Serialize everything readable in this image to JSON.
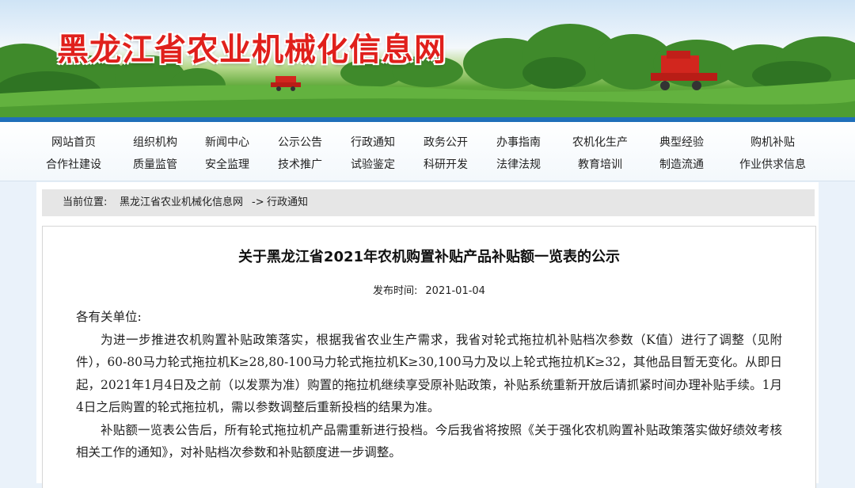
{
  "site": {
    "title": "黑龙江省农业机械化信息网"
  },
  "nav": {
    "row1": [
      "网站首页",
      "组织机构",
      "新闻中心",
      "公示公告",
      "行政通知",
      "政务公开",
      "办事指南",
      "农机化生产",
      "典型经验",
      "购机补贴"
    ],
    "row2": [
      "合作社建设",
      "质量监管",
      "安全监理",
      "技术推广",
      "试验鉴定",
      "科研开发",
      "法律法规",
      "教育培训",
      "制造流通",
      "作业供求信息"
    ]
  },
  "breadcrumb": {
    "label": "当前位置:",
    "home": "黑龙江省农业机械化信息网",
    "separator": "->",
    "current": "行政通知"
  },
  "article": {
    "title": "关于黑龙江省2021年农机购置补贴产品补贴额一览表的公示",
    "date_label": "发布时间:",
    "date": "2021-01-04",
    "salutation": "各有关单位:",
    "paragraphs": [
      "为进一步推进农机购置补贴政策落实，根据我省农业生产需求，我省对轮式拖拉机补贴档次参数（K值）进行了调整（见附件），60-80马力轮式拖拉机K≥28,80-100马力轮式拖拉机K≥30,100马力及以上轮式拖拉机K≥32，其他品目暂无变化。从即日起，2021年1月4日及之前（以发票为准）购置的拖拉机继续享受原补贴政策，补贴系统重新开放后请抓紧时间办理补贴手续。1月4日之后购置的轮式拖拉机，需以参数调整后重新投档的结果为准。",
      "补贴额一览表公告后，所有轮式拖拉机产品需重新进行投档。今后我省将按照《关于强化农机购置补贴政策落实做好绩效考核相关工作的通知》，对补贴档次参数和补贴额度进一步调整。"
    ]
  },
  "colors": {
    "title_red": "#e0201c",
    "nav_rule_blue": "#1f6fb9"
  }
}
